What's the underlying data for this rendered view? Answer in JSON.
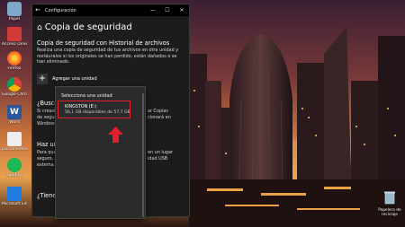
{
  "window": {
    "app_title": "Configuración",
    "controls": {
      "minimize": "—",
      "maximize": "☐",
      "close": "✕"
    },
    "page_title": "Copia de seguridad",
    "section_title": "Copia de seguridad con Historial de archivos",
    "section_description": "Realiza una copia de seguridad de tus archivos en otra unidad y restáuralos si los originales se han perdido, están dañados o se han eliminado.",
    "add_drive_label": "Agregar una unidad",
    "obscured": {
      "heading_1": "¿Buscas u",
      "line_1a": "Si creaste u",
      "line_1a_right": "ar Copias",
      "line_1b": "de seguridad",
      "line_1b_right": "cionará en",
      "line_1c": "Windows 1",
      "heading_2": "Haz una",
      "line_2a": "Para que W",
      "line_2a_right": "en un lugar",
      "line_2b": "seguro, elig",
      "line_2b_right": "idad USB",
      "line_2c": "externa o u",
      "heading_3": "¿Tienes u"
    }
  },
  "flyout": {
    "heading": "Selecciona una unidad",
    "drive_name": "KINGSTON (E:)",
    "drive_space": "56,1 GB disponibles de 57,7 GB"
  },
  "desktop": {
    "icons": [
      {
        "label": "Papel",
        "icon": "recycle-icon"
      },
      {
        "label": "Acceso Directo",
        "icon": "shortcut-icon"
      },
      {
        "label": "Firefox",
        "icon": "firefox-icon"
      },
      {
        "label": "Google Chrome",
        "icon": "chrome-icon"
      },
      {
        "label": "Word",
        "icon": "word-icon"
      },
      {
        "label": "Documentos",
        "icon": "documents-icon"
      },
      {
        "label": "Spotify",
        "icon": "spotify-icon"
      },
      {
        "label": "Microsoft Edge",
        "icon": "edge-icon"
      }
    ],
    "recycle_bin_label": "Papelera de reciclaje"
  },
  "colors": {
    "window_bg": "#1c1c1c",
    "flyout_bg": "#2b2b2b",
    "highlight": "#e0202a",
    "arrow": "#e0202a"
  }
}
